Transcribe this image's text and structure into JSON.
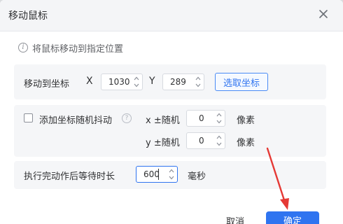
{
  "dialog": {
    "title": "移动鼠标",
    "hint": "将鼠标移动到指定位置"
  },
  "move_to": {
    "label": "移动到坐标",
    "x_label": "X",
    "x_value": "1030",
    "y_label": "Y",
    "y_value": "289",
    "pick_button": "选取坐标"
  },
  "jitter": {
    "checked": false,
    "label": "添加坐标随机抖动",
    "x_label": "x ±随机",
    "x_value": "0",
    "x_unit": "像素",
    "y_label": "y ±随机",
    "y_value": "0",
    "y_unit": "像素"
  },
  "wait": {
    "label": "执行完动作后等待时长",
    "value": "600",
    "unit": "毫秒"
  },
  "footer": {
    "cancel": "取消",
    "ok": "确定"
  },
  "annotation": {
    "arrow_color": "#e53935"
  }
}
